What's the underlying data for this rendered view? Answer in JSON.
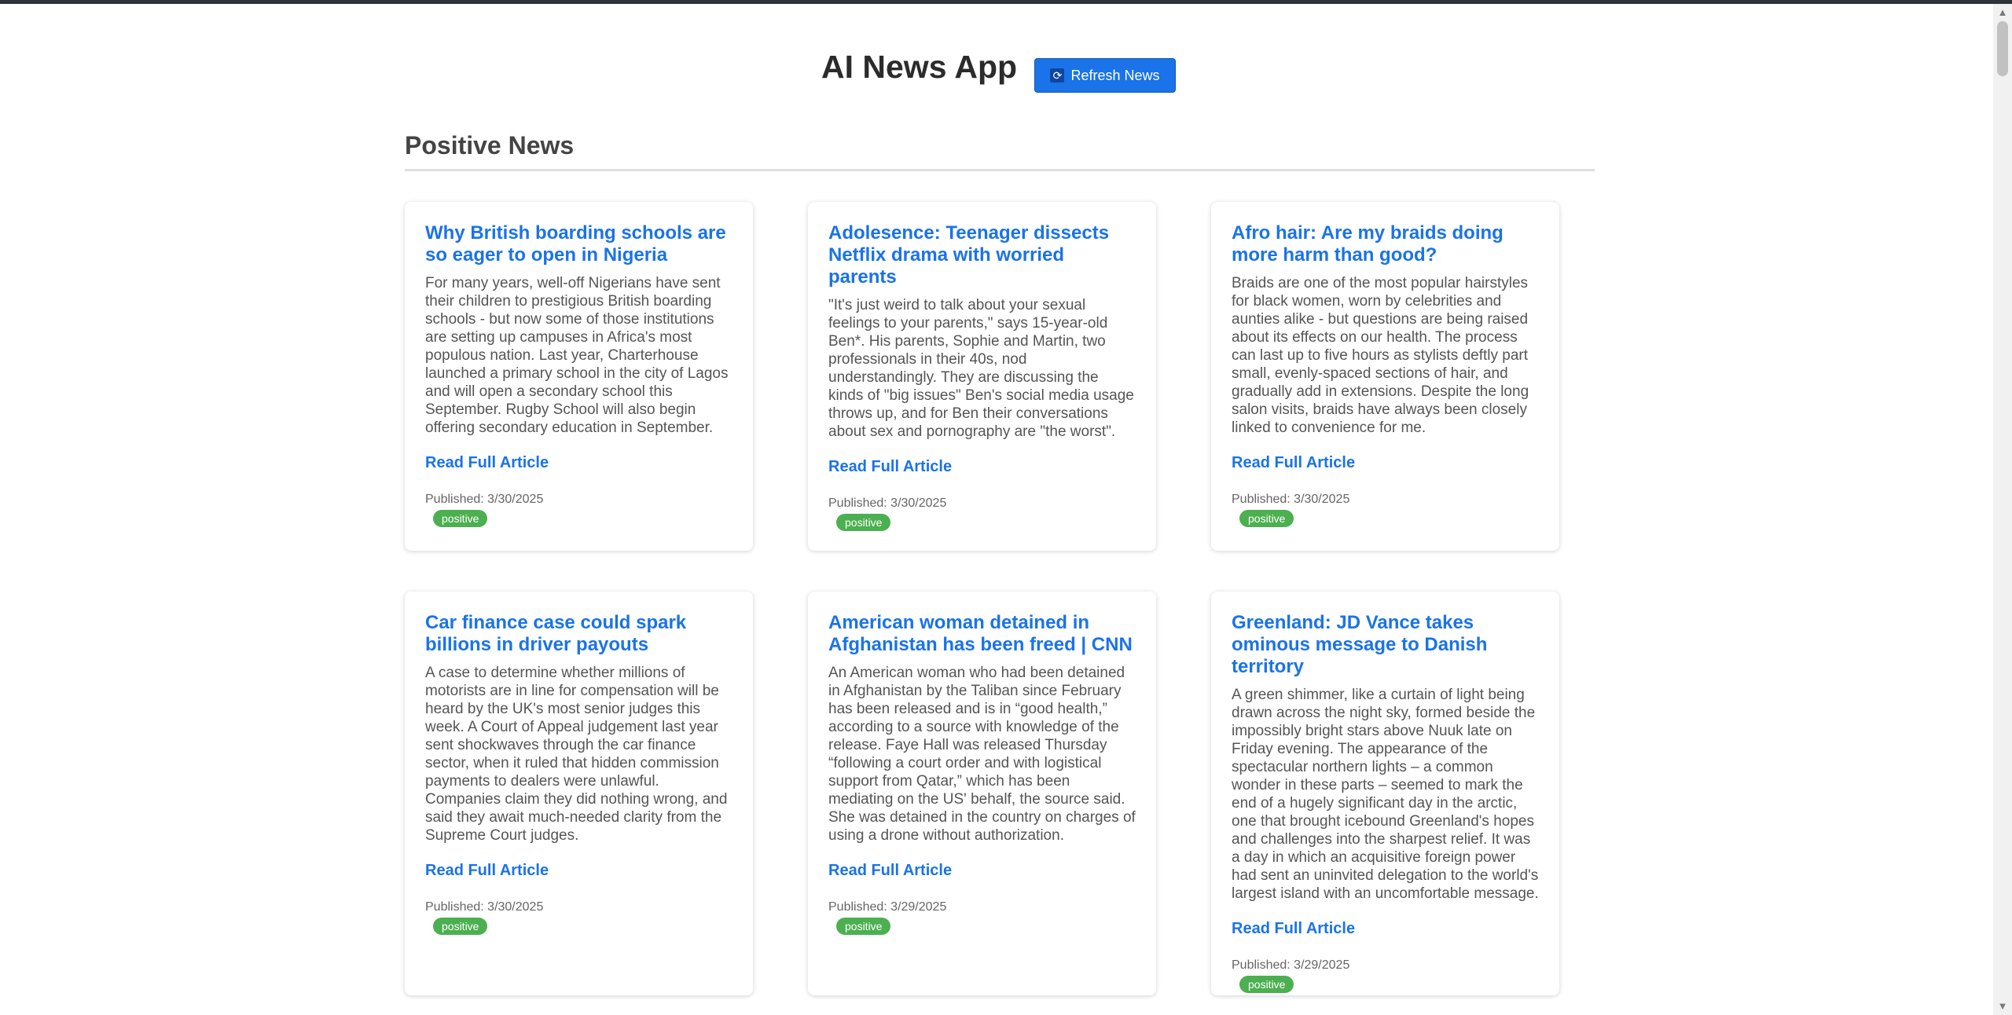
{
  "app": {
    "title": "AI News App",
    "refresh_label": "Refresh News",
    "refresh_icon": "refresh-icon"
  },
  "section": {
    "title": "Positive News"
  },
  "read_more_label": "Read Full Article",
  "published_prefix": "Published:",
  "articles": [
    {
      "title": "Why British boarding schools are so eager to open in Nigeria",
      "description": "For many years, well-off Nigerians have sent their children to prestigious British boarding schools - but now some of those institutions are setting up campuses in Africa's most populous nation. Last year, Charterhouse launched a primary school in the city of Lagos and will open a secondary school this September. Rugby School will also begin offering secondary education in September.",
      "published": "Published: 3/30/2025",
      "sentiment": "positive"
    },
    {
      "title": "Adolesence: Teenager dissects Netflix drama with worried parents",
      "description": "\"It's just weird to talk about your sexual feelings to your parents,\" says 15-year-old Ben*. His parents, Sophie and Martin, two professionals in their 40s, nod understandingly. They are discussing the kinds of \"big issues\" Ben's social media usage throws up, and for Ben their conversations about sex and pornography are \"the worst\".",
      "published": "Published: 3/30/2025",
      "sentiment": "positive"
    },
    {
      "title": "Afro hair: Are my braids doing more harm than good?",
      "description": "Braids are one of the most popular hairstyles for black women, worn by celebrities and aunties alike - but questions are being raised about its effects on our health. The process can last up to five hours as stylists deftly part small, evenly-spaced sections of hair, and gradually add in extensions. Despite the long salon visits, braids have always been closely linked to convenience for me.",
      "published": "Published: 3/30/2025",
      "sentiment": "positive"
    },
    {
      "title": "Car finance case could spark billions in driver payouts",
      "description": "A case to determine whether millions of motorists are in line for compensation will be heard by the UK's most senior judges this week. A Court of Appeal judgement last year sent shockwaves through the car finance sector, when it ruled that hidden commission payments to dealers were unlawful. Companies claim they did nothing wrong, and said they await much-needed clarity from the Supreme Court judges.",
      "published": "Published: 3/30/2025",
      "sentiment": "positive"
    },
    {
      "title": "American woman detained in Afghanistan has been freed | CNN",
      "description": "An American woman who had been detained in Afghanistan by the Taliban since February has been released and is in “good health,” according to a source with knowledge of the release. Faye Hall was released Thursday “following a court order and with logistical support from Qatar,” which has been mediating on the US' behalf, the source said. She was detained in the country on charges of using a drone without authorization.",
      "published": "Published: 3/29/2025",
      "sentiment": "positive"
    },
    {
      "title": "Greenland: JD Vance takes ominous message to Danish territory",
      "description": "A green shimmer, like a curtain of light being drawn across the night sky, formed beside the impossibly bright stars above Nuuk late on Friday evening. The appearance of the spectacular northern lights – a common wonder in these parts – seemed to mark the end of a hugely significant day in the arctic, one that brought icebound Greenland's hopes and challenges into the sharpest relief. It was a day in which an acquisitive foreign power had sent an uninvited delegation to the world's largest island with an uncomfortable message.",
      "published": "Published: 3/29/2025",
      "sentiment": "positive"
    }
  ]
}
